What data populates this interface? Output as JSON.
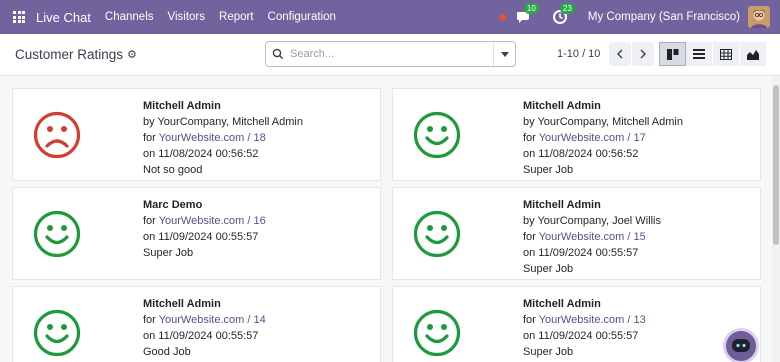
{
  "navbar": {
    "brand": "Live Chat",
    "menu": [
      "Channels",
      "Visitors",
      "Report",
      "Configuration"
    ],
    "messages_count": "10",
    "activities_count": "23",
    "company": "My Company (San Francisco)"
  },
  "control": {
    "title": "Customer Ratings",
    "search_placeholder": "Search...",
    "pager": "1-10 / 10"
  },
  "colors": {
    "happy": "#1e9a3c",
    "sad": "#d23f31",
    "brand": "#71639e",
    "link": "#5b4d8e"
  },
  "cards": [
    {
      "face": "sad",
      "name": "Mitchell Admin",
      "by": "by YourCompany, Mitchell Admin",
      "for_prefix": "for ",
      "for_link": "YourWebsite.com / 18",
      "date": "on 11/08/2024 00:56:52",
      "feedback": "Not so good"
    },
    {
      "face": "happy",
      "name": "Mitchell Admin",
      "by": "by YourCompany, Mitchell Admin",
      "for_prefix": "for ",
      "for_link": "YourWebsite.com / 17",
      "date": "on 11/08/2024 00:56:52",
      "feedback": "Super Job"
    },
    {
      "face": "happy",
      "name": "Marc Demo",
      "by": "",
      "for_prefix": "for ",
      "for_link": "YourWebsite.com / 16",
      "date": "on 11/09/2024 00:55:57",
      "feedback": "Super Job"
    },
    {
      "face": "happy",
      "name": "Mitchell Admin",
      "by": "by YourCompany, Joel Willis",
      "for_prefix": "for ",
      "for_link": "YourWebsite.com / 15",
      "date": "on 11/09/2024 00:55:57",
      "feedback": "Super Job"
    },
    {
      "face": "happy",
      "name": "Mitchell Admin",
      "by": "",
      "for_prefix": "for ",
      "for_link": "YourWebsite.com / 14",
      "date": "on 11/09/2024 00:55:57",
      "feedback": "Good Job"
    },
    {
      "face": "happy",
      "name": "Mitchell Admin",
      "by": "",
      "for_prefix": "for ",
      "for_link": "YourWebsite.com / 13",
      "date": "on 11/09/2024 00:55:57",
      "feedback": "Super Job"
    }
  ]
}
